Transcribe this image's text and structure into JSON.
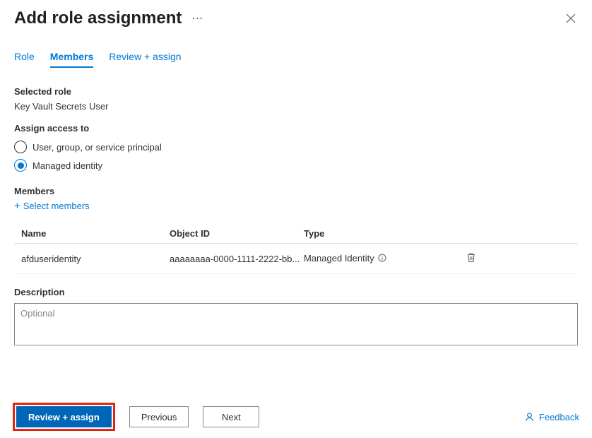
{
  "header": {
    "title": "Add role assignment"
  },
  "tabs": {
    "role": "Role",
    "members": "Members",
    "review": "Review + assign"
  },
  "selected_role": {
    "label": "Selected role",
    "value": "Key Vault Secrets User"
  },
  "assign_access": {
    "label": "Assign access to",
    "options": {
      "user_group": "User, group, or service principal",
      "managed_identity": "Managed identity"
    },
    "selected": "managed_identity"
  },
  "members_section": {
    "label": "Members",
    "select_link": "Select members"
  },
  "table": {
    "headers": {
      "name": "Name",
      "object_id": "Object ID",
      "type": "Type"
    },
    "rows": [
      {
        "name": "afduseridentity",
        "object_id": "aaaaaaaa-0000-1111-2222-bb...",
        "type": "Managed Identity"
      }
    ]
  },
  "description": {
    "label": "Description",
    "placeholder": "Optional"
  },
  "footer": {
    "review": "Review + assign",
    "previous": "Previous",
    "next": "Next",
    "feedback": "Feedback"
  }
}
